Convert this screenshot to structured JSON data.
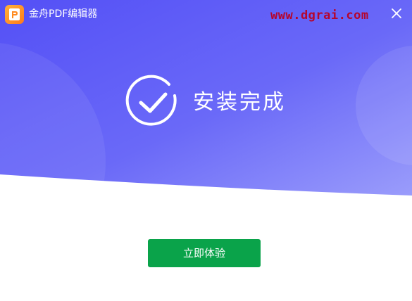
{
  "window": {
    "title": "金舟PDF编辑器",
    "watermark": "www.dgrai.com",
    "logo_letter": "P"
  },
  "status": {
    "text": "安装完成",
    "icon": "check-circle-icon"
  },
  "actions": {
    "start_label": "立即体验"
  },
  "colors": {
    "hero_gradient_start": "#5a57f7",
    "hero_gradient_end": "#8f8ffb",
    "accent_green": "#0aa34a",
    "logo_orange": "#ff8a1f",
    "watermark_red": "#b5062e"
  }
}
